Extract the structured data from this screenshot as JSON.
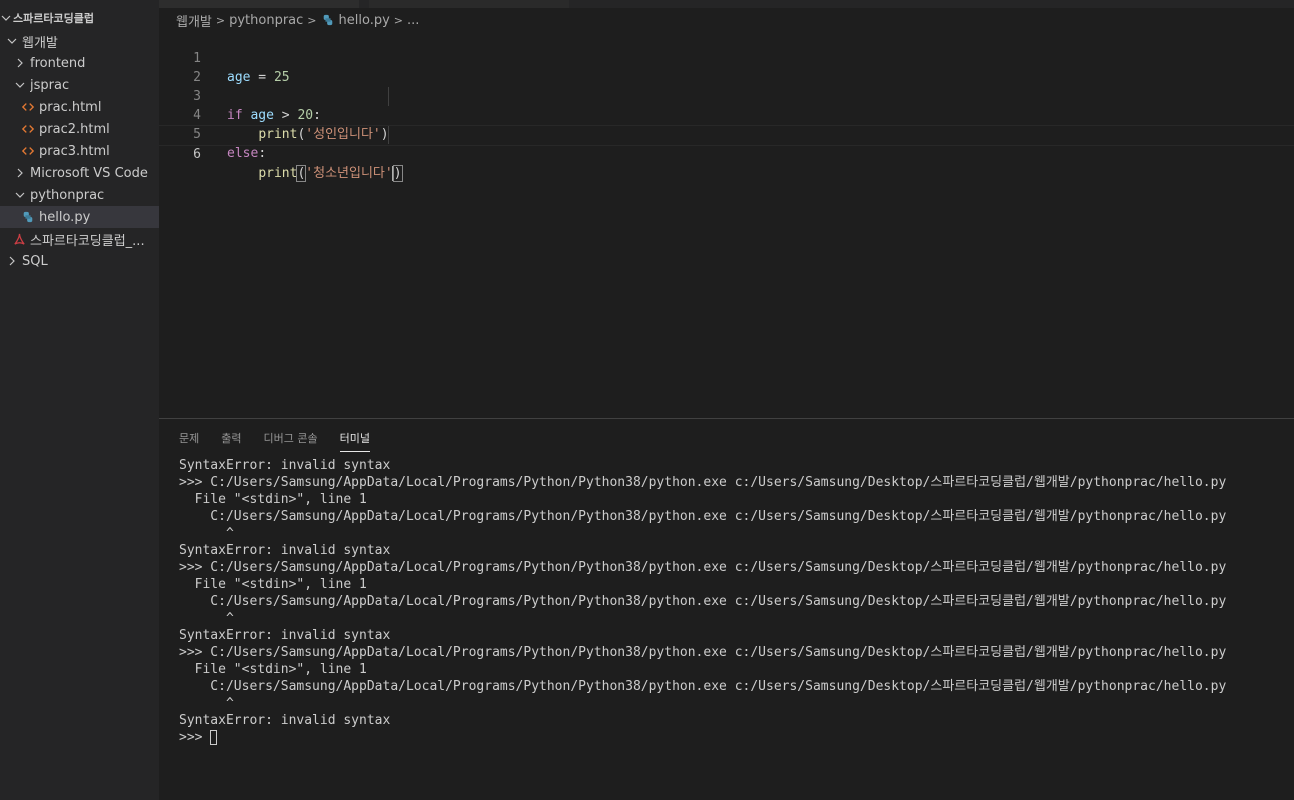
{
  "explorer": {
    "root_label": "스파르타코딩클럽",
    "items": [
      {
        "label": "웹개발",
        "kind": "folder-open"
      },
      {
        "label": "frontend",
        "kind": "folder-closed"
      },
      {
        "label": "jsprac",
        "kind": "folder-open"
      },
      {
        "label": "prac.html",
        "kind": "html-file"
      },
      {
        "label": "prac2.html",
        "kind": "html-file"
      },
      {
        "label": "prac3.html",
        "kind": "html-file"
      },
      {
        "label": "Microsoft VS Code",
        "kind": "folder-closed"
      },
      {
        "label": "pythonprac",
        "kind": "folder-open"
      },
      {
        "label": "hello.py",
        "kind": "python-file",
        "selected": true
      },
      {
        "label": "스파르타코딩클럽_...",
        "kind": "pdf-file"
      },
      {
        "label": "SQL",
        "kind": "folder-closed"
      }
    ]
  },
  "breadcrumb": {
    "parts": [
      "웹개발",
      "pythonprac",
      "hello.py",
      "..."
    ]
  },
  "editor": {
    "lines": [
      {
        "n": "1"
      },
      {
        "n": "2"
      },
      {
        "n": "3"
      },
      {
        "n": "4",
        "str": "'성인입니다'"
      },
      {
        "n": "5"
      },
      {
        "n": "6",
        "str": "'청소년입니다'"
      }
    ],
    "tokens": {
      "age": "age",
      "eq": " = ",
      "twenty_five": "25",
      "if": "if",
      "gt": " > ",
      "twenty": "20",
      "colon": ":",
      "print": "print",
      "lparen": "(",
      "rparen": ")",
      "else": "else"
    }
  },
  "panel": {
    "tabs": [
      "문제",
      "출력",
      "디버그 콘솔",
      "터미널"
    ],
    "active_tab": "터미널"
  },
  "terminal": {
    "lines": [
      "SyntaxError: invalid syntax",
      ">>> C:/Users/Samsung/AppData/Local/Programs/Python/Python38/python.exe c:/Users/Samsung/Desktop/스파르타코딩클럽/웹개발/pythonprac/hello.py",
      "  File \"<stdin>\", line 1",
      "    C:/Users/Samsung/AppData/Local/Programs/Python/Python38/python.exe c:/Users/Samsung/Desktop/스파르타코딩클럽/웹개발/pythonprac/hello.py",
      "      ^",
      "SyntaxError: invalid syntax",
      ">>> C:/Users/Samsung/AppData/Local/Programs/Python/Python38/python.exe c:/Users/Samsung/Desktop/스파르타코딩클럽/웹개발/pythonprac/hello.py",
      "  File \"<stdin>\", line 1",
      "    C:/Users/Samsung/AppData/Local/Programs/Python/Python38/python.exe c:/Users/Samsung/Desktop/스파르타코딩클럽/웹개발/pythonprac/hello.py",
      "      ^",
      "SyntaxError: invalid syntax",
      ">>> C:/Users/Samsung/AppData/Local/Programs/Python/Python38/python.exe c:/Users/Samsung/Desktop/스파르타코딩클럽/웹개발/pythonprac/hello.py",
      "  File \"<stdin>\", line 1",
      "    C:/Users/Samsung/AppData/Local/Programs/Python/Python38/python.exe c:/Users/Samsung/Desktop/스파르타코딩클럽/웹개발/pythonprac/hello.py",
      "      ^",
      "SyntaxError: invalid syntax"
    ],
    "prompt": ">>> "
  },
  "colors": {
    "accent_html_icon": "#e37933",
    "accent_python_icon": "#519aba",
    "accent_pdf_icon": "#cc3e44"
  }
}
